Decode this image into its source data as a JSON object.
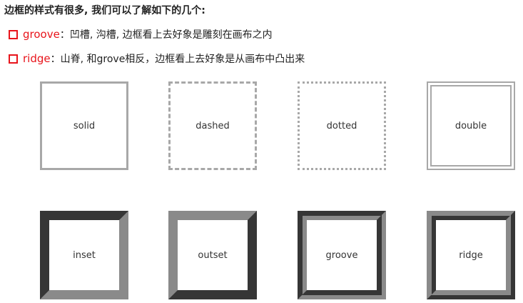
{
  "heading": "边框的样式有很多, 我们可以了解如下的几个:",
  "bullets": [
    {
      "keyword": "groove",
      "text": "：凹槽, 沟槽, 边框看上去好象是雕刻在画布之内"
    },
    {
      "keyword": "ridge",
      "text": "：山脊, 和grove相反，边框看上去好象是从画布中凸出来"
    }
  ],
  "boxes": {
    "row1": [
      "solid",
      "dashed",
      "dotted",
      "double"
    ],
    "row2": [
      "inset",
      "outset",
      "groove",
      "ridge"
    ]
  },
  "colors": {
    "accent": "#e8141b",
    "border_gray": "#a8a8a8",
    "text": "#222222"
  }
}
